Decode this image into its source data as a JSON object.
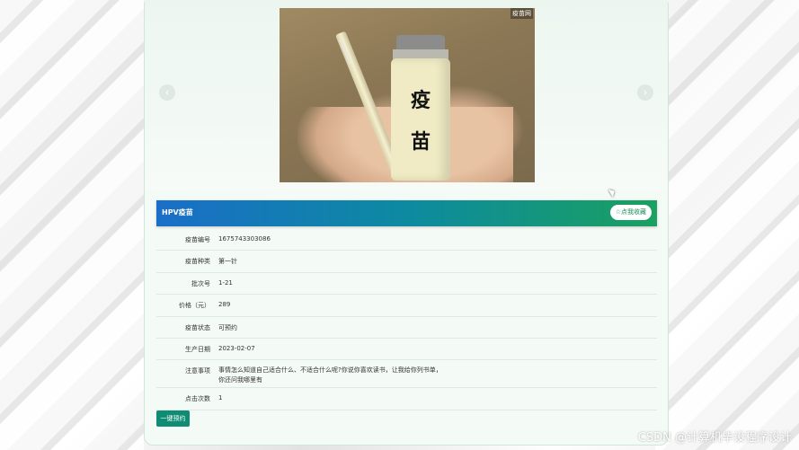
{
  "carousel": {
    "vial_text_1": "疫",
    "vial_text_2": "苗",
    "corner_badge": "疫苗网",
    "prev_icon": "chevron-left-icon",
    "next_icon": "chevron-right-icon"
  },
  "vaccine": {
    "name": "HPV疫苗",
    "favorite_label": "☆点我收藏",
    "book_label": "一键预约",
    "fields": [
      {
        "label": "疫苗编号",
        "value": "1675743303086"
      },
      {
        "label": "疫苗种类",
        "value": "第一针"
      },
      {
        "label": "批次号",
        "value": "1-21"
      },
      {
        "label": "价格（元）",
        "value": "289"
      },
      {
        "label": "疫苗状态",
        "value": "可预约"
      },
      {
        "label": "生产日期",
        "value": "2023-02-07"
      },
      {
        "label": "注意事项",
        "value": "事情怎么知道自己适合什么、不适合什么呢?你说你喜欢读书，让我给你列书单，你还问我哪里有"
      },
      {
        "label": "点击次数",
        "value": "1"
      }
    ]
  },
  "watermark": "CSDN @计算机毕设程序设计",
  "colors": {
    "header_start": "#1a6ec8",
    "header_end": "#1aa060",
    "book_button": "#0e8c74"
  }
}
